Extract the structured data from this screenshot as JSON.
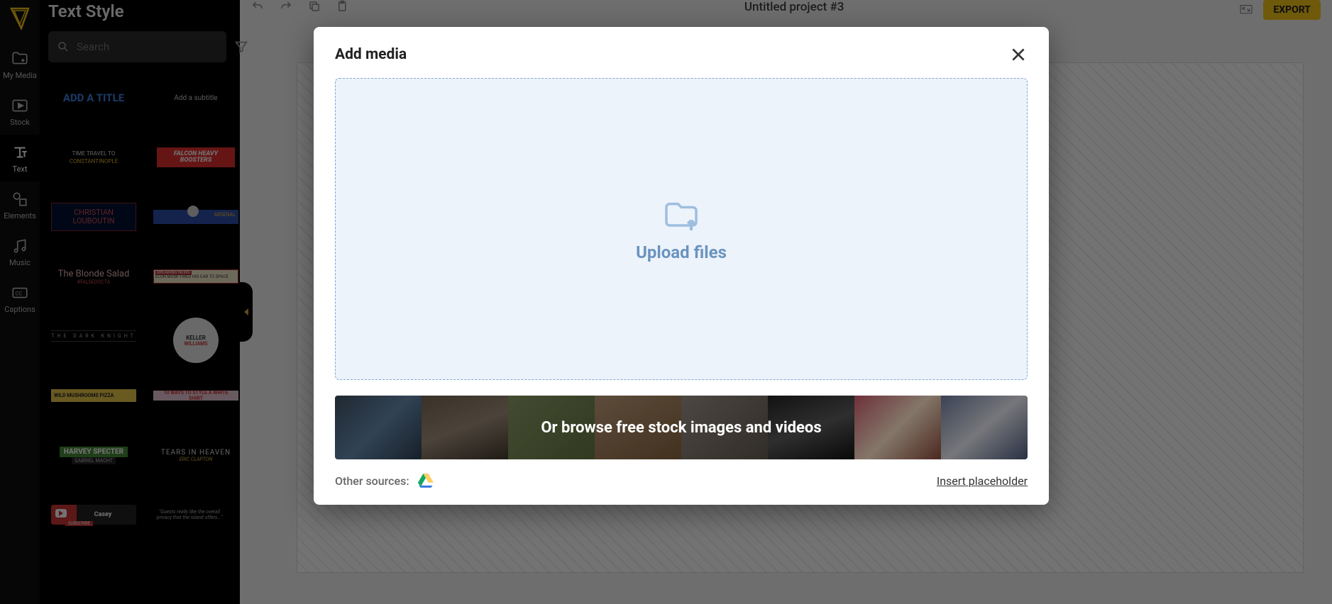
{
  "header": {
    "project_title": "Untitled project #3",
    "export_label": "EXPORT"
  },
  "rail": {
    "items": [
      {
        "label": "My Media"
      },
      {
        "label": "Stock"
      },
      {
        "label": "Text"
      },
      {
        "label": "Elements"
      },
      {
        "label": "Music"
      },
      {
        "label": "Captions"
      }
    ]
  },
  "side_panel": {
    "title": "Text Style",
    "search_placeholder": "Search"
  },
  "text_styles": {
    "s1": "ADD A TITLE",
    "s2": "Add a subtitle",
    "s3a": "TIME TRAVEL TO",
    "s3b": "CONSTANTINOPLE",
    "s4a": "FALCON HEAVY",
    "s4b": "BOOSTERS",
    "s5a": "CHRISTIAN",
    "s5b": "LOUBOUTIN",
    "s6": "ARSENAL",
    "s7a": "The Blonde Salad",
    "s7b": "#FALSEDOCTA",
    "s8h": "BREAKING NEWS",
    "s8t": "ELON MUSK FIRED HIS CAR TO SPACE",
    "s9": "THE DARK KNIGHT",
    "s10a": "KELLER",
    "s10b": "WILLIAMS",
    "s11": "WILD MUSHROOMS PIZZA",
    "s12": "10 WAYS TO STYLE A WHITE SHIRT",
    "s13a": "HARVEY SPECTER",
    "s13b": "GABRIEL MACHT",
    "s14a": "TEARS IN HEAVEN",
    "s14b": "ERIC CLAPTON",
    "s15a": "Casey",
    "s15b": "SUBSCRIBE",
    "s16": "\"Guests really like the overall privacy that the island offers...\""
  },
  "modal": {
    "title": "Add media",
    "upload_label": "Upload files",
    "stock_banner_text": "Or browse free stock images and videos",
    "other_sources_label": "Other sources:",
    "insert_placeholder_label": "Insert placeholder"
  }
}
